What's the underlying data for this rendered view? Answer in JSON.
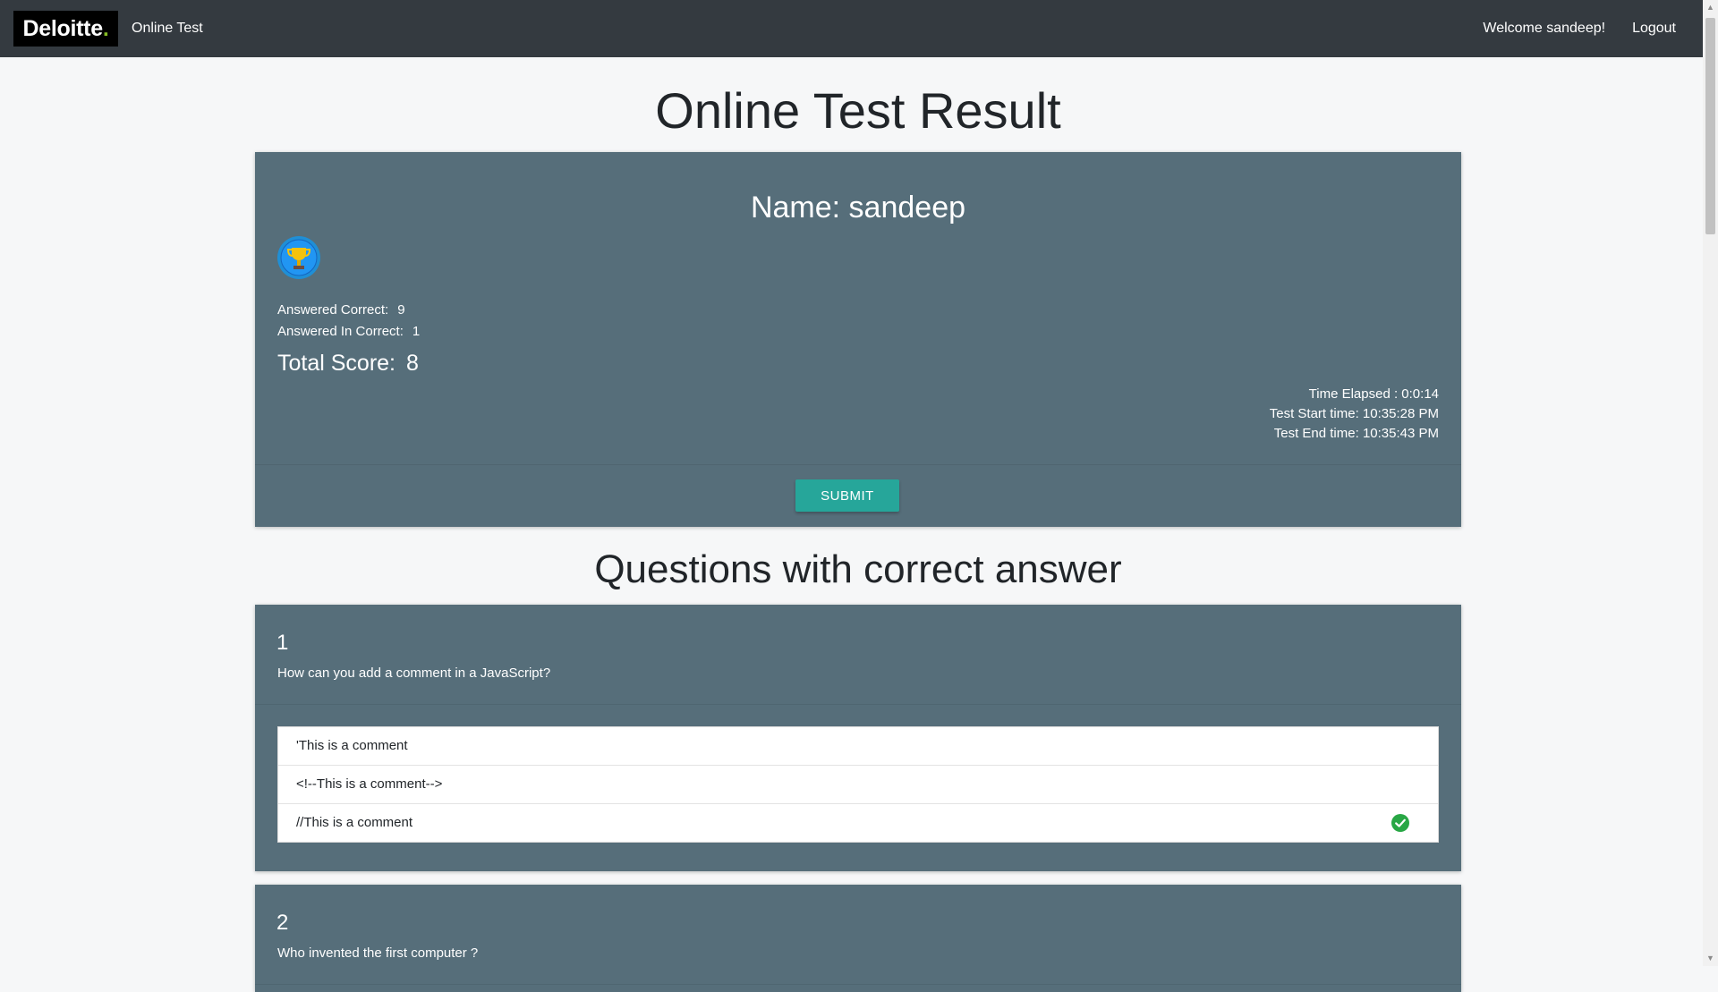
{
  "navbar": {
    "brand": "Deloitte",
    "brand_dot": ".",
    "app_link": "Online Test",
    "welcome": "Welcome sandeep!",
    "logout": "Logout"
  },
  "page_title": "Online Test Result",
  "result": {
    "name_label": "Name: sandeep",
    "correct_label": "Answered Correct:",
    "correct_value": "9",
    "incorrect_label": "Answered In Correct:",
    "incorrect_value": "1",
    "total_label": "Total Score:",
    "total_value": "8",
    "time_elapsed": "Time Elapsed : 0:0:14",
    "start_time": "Test Start time: 10:35:28 PM",
    "end_time": "Test End time: 10:35:43 PM",
    "submit": "SUBMIT"
  },
  "section_title": "Questions with correct answer",
  "questions": [
    {
      "number": "1",
      "text": "How can you add a comment in a JavaScript?",
      "answers": [
        "'This is a comment",
        "<!--This is a comment-->",
        "//This is a comment"
      ],
      "correct_index": 2
    },
    {
      "number": "2",
      "text": "Who invented the first computer ?"
    }
  ],
  "colors": {
    "navbar": "#343a40",
    "card": "#566e7a",
    "submit": "#26a69a",
    "correct": "#28a745",
    "brand_accent": "#86bc25"
  }
}
